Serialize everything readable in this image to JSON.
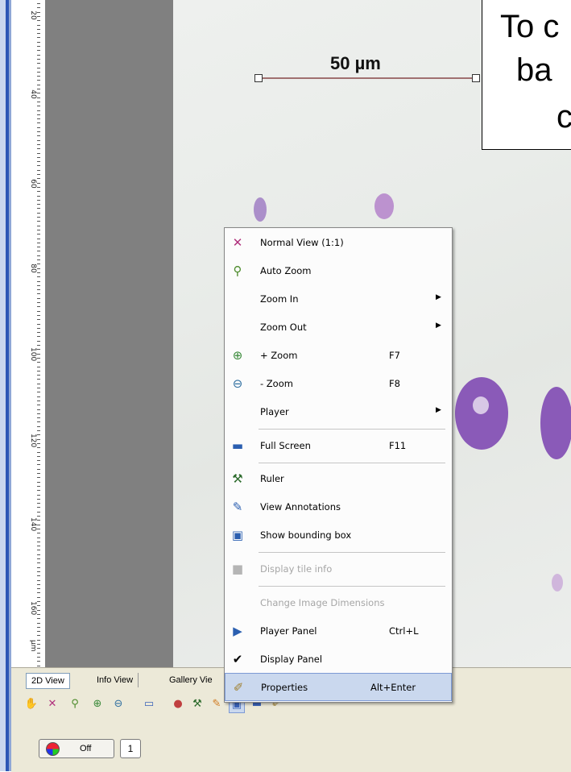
{
  "ruler": {
    "unit": "µm",
    "labels": [
      "20",
      "40",
      "60",
      "80",
      "100",
      "120",
      "140",
      "160"
    ]
  },
  "image": {
    "scale_bar": {
      "label": "50 µm"
    }
  },
  "callout": {
    "line1": "To c",
    "line2": "ba",
    "line3": "c"
  },
  "context_menu": {
    "items": [
      {
        "label": "Normal View (1:1)",
        "shortcut": "",
        "icon": "normal-view-icon",
        "submenu": false,
        "disabled": false
      },
      {
        "label": "Auto Zoom",
        "shortcut": "",
        "icon": "auto-zoom-icon",
        "submenu": false,
        "disabled": false
      },
      {
        "label": "Zoom In",
        "shortcut": "",
        "icon": "",
        "submenu": true,
        "disabled": false
      },
      {
        "label": "Zoom Out",
        "shortcut": "",
        "icon": "",
        "submenu": true,
        "disabled": false
      },
      {
        "label": "+ Zoom",
        "shortcut": "F7",
        "icon": "zoom-plus-icon",
        "submenu": false,
        "disabled": false
      },
      {
        "label": "- Zoom",
        "shortcut": "F8",
        "icon": "zoom-minus-icon",
        "submenu": false,
        "disabled": false
      },
      {
        "label": "Player",
        "shortcut": "",
        "icon": "",
        "submenu": true,
        "disabled": false
      },
      {
        "label": "Full Screen",
        "shortcut": "F11",
        "icon": "full-screen-icon",
        "submenu": false,
        "disabled": false
      },
      {
        "label": "Ruler",
        "shortcut": "",
        "icon": "ruler-icon",
        "submenu": false,
        "disabled": false
      },
      {
        "label": "View Annotations",
        "shortcut": "",
        "icon": "annotations-icon",
        "submenu": false,
        "disabled": false
      },
      {
        "label": "Show bounding box",
        "shortcut": "",
        "icon": "bounding-box-icon",
        "submenu": false,
        "disabled": false
      },
      {
        "label": "Display tile info",
        "shortcut": "",
        "icon": "tile-info-icon",
        "submenu": false,
        "disabled": true
      },
      {
        "label": "Change Image Dimensions",
        "shortcut": "",
        "icon": "",
        "submenu": false,
        "disabled": true
      },
      {
        "label": "Player Panel",
        "shortcut": "Ctrl+L",
        "icon": "player-panel-icon",
        "submenu": false,
        "disabled": false
      },
      {
        "label": "Display Panel",
        "shortcut": "",
        "icon": "checkmark-icon",
        "submenu": false,
        "disabled": false
      },
      {
        "label": "Properties",
        "shortcut": "Alt+Enter",
        "icon": "properties-icon",
        "submenu": false,
        "disabled": false,
        "highlighted": true
      }
    ]
  },
  "bottom": {
    "tabs": [
      "2D View",
      "Info View",
      "Gallery Vie"
    ],
    "toggle_label": "Off",
    "channel_value": "1"
  },
  "colors": {
    "frame_blue": "#2b55b5",
    "menu_highlight": "#cad8ee",
    "cell_purple": "#8a5ab8"
  }
}
